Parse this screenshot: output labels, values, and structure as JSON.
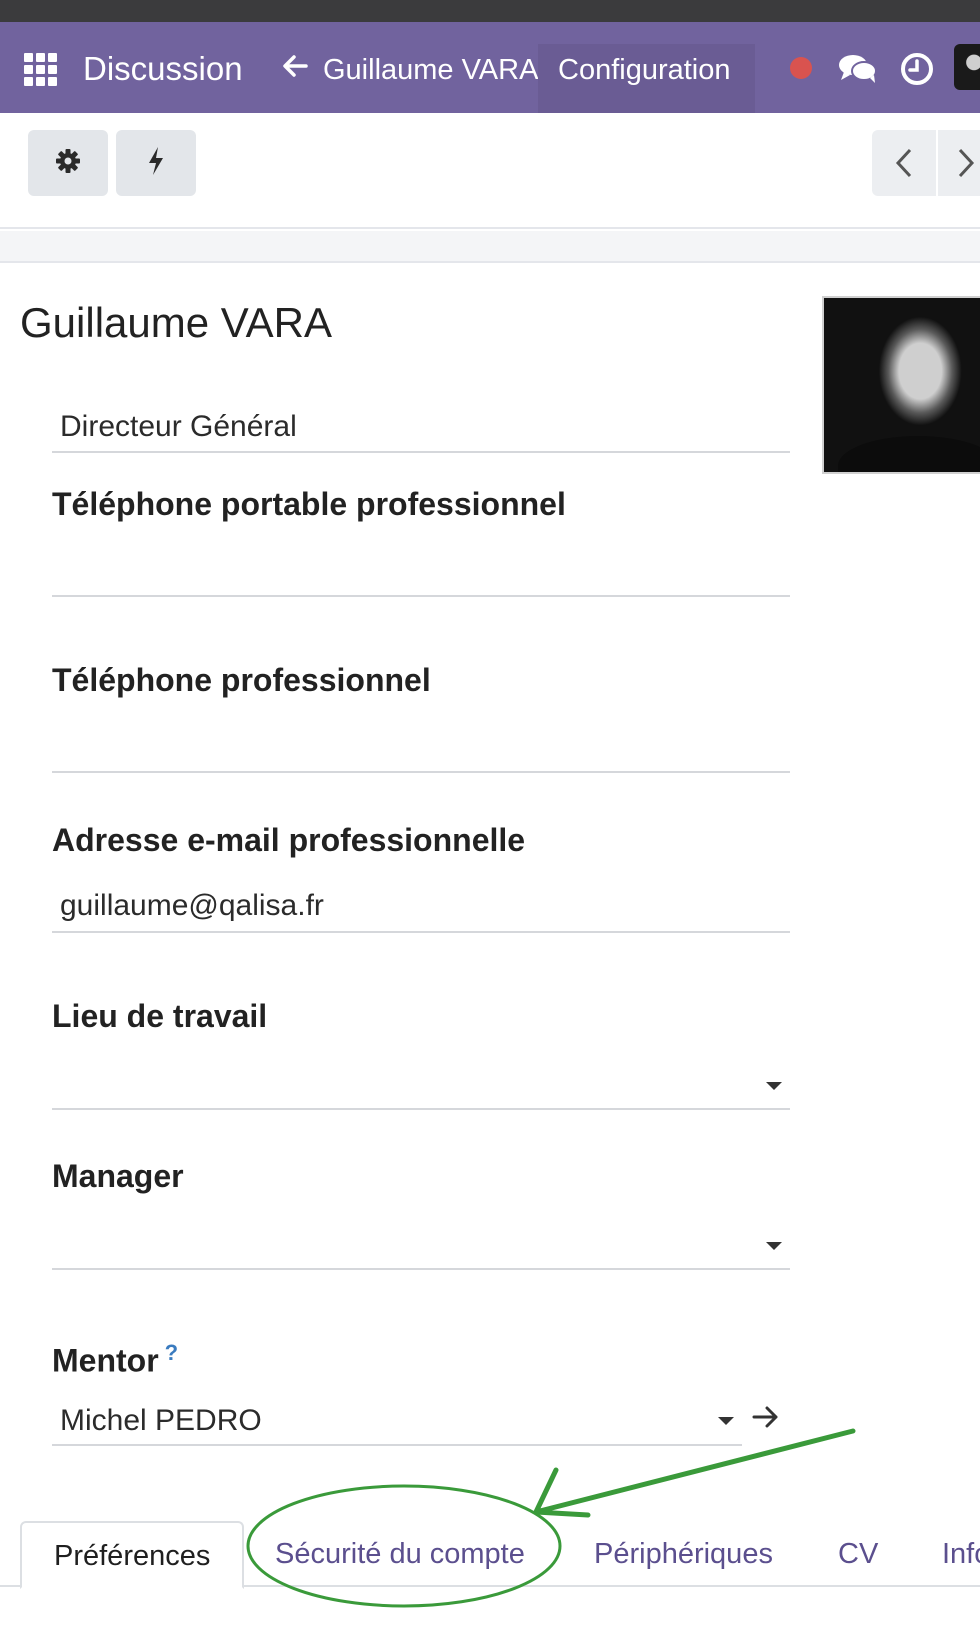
{
  "navbar": {
    "app_name": "Discussion",
    "breadcrumb_back": "Guillaume VARA",
    "menu_configuration": "Configuration",
    "accent_color": "#71639e"
  },
  "control_panel": {
    "icons": [
      "gear-icon",
      "bolt-icon",
      "chevron-left-icon",
      "chevron-right-icon"
    ]
  },
  "employee": {
    "name": "Guillaume VARA",
    "job_title": "Directeur Général"
  },
  "fields": {
    "mobile_label": "Téléphone portable professionnel",
    "mobile_value": "",
    "phone_label": "Téléphone professionnel",
    "phone_value": "",
    "email_label": "Adresse e-mail professionnelle",
    "email_value": "guillaume@qalisa.fr",
    "work_location_label": "Lieu de travail",
    "work_location_value": "",
    "manager_label": "Manager",
    "manager_value": "",
    "mentor_label": "Mentor",
    "mentor_help": "?",
    "mentor_value": "Michel PEDRO"
  },
  "tabs": [
    {
      "label": "Préférences",
      "active": true
    },
    {
      "label": "Sécurité du compte",
      "active": false
    },
    {
      "label": "Périphériques",
      "active": false
    },
    {
      "label": "CV",
      "active": false
    },
    {
      "label": "Info",
      "active": false
    }
  ],
  "annotation": {
    "color": "#3a9a3a",
    "highlighted_tab": "Sécurité du compte"
  }
}
